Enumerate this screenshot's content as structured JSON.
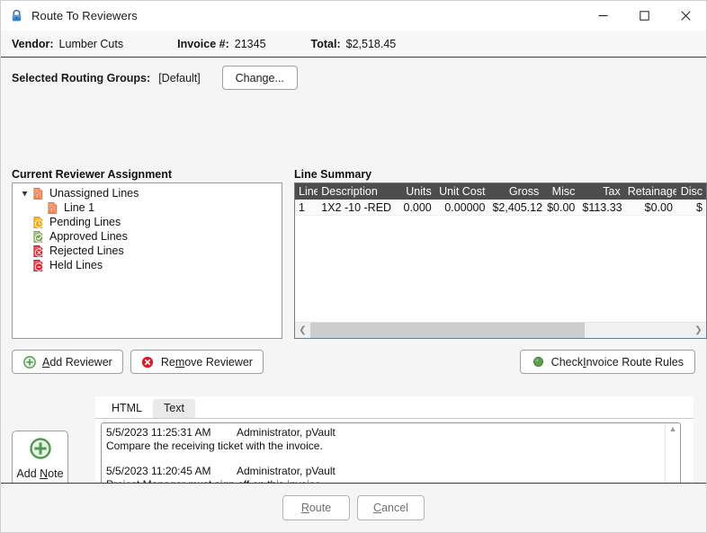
{
  "window": {
    "title": "Route To Reviewers",
    "icon": "lock-icon",
    "controls": {
      "minimize": "minimize-icon",
      "maximize": "maximize-icon",
      "close": "close-icon"
    }
  },
  "info": {
    "vendor_label": "Vendor:",
    "vendor_value": "Lumber Cuts",
    "invoice_label": "Invoice #:",
    "invoice_value": "21345",
    "total_label": "Total:",
    "total_value": "$2,518.45"
  },
  "routing": {
    "label": "Selected Routing Groups:",
    "value": "[Default]",
    "change_button": "Change..."
  },
  "left_panel": {
    "heading": "Current Reviewer Assignment",
    "tree": [
      {
        "label": "Unassigned Lines",
        "icon": "page-warning-icon",
        "color": "#e8825c",
        "level": 0,
        "expanded": true
      },
      {
        "label": "Line 1",
        "icon": "page-warning-icon",
        "color": "#e8825c",
        "level": 1,
        "expanded": false
      },
      {
        "label": "Pending Lines",
        "icon": "page-clock-icon",
        "color": "#f0a81e",
        "level": 0,
        "expanded": false
      },
      {
        "label": "Approved Lines",
        "icon": "page-check-icon",
        "color": "#7ba05b",
        "level": 0,
        "expanded": false
      },
      {
        "label": "Rejected Lines",
        "icon": "page-reject-icon",
        "color": "#e01a28",
        "level": 0,
        "expanded": false
      },
      {
        "label": "Held Lines",
        "icon": "page-hold-icon",
        "color": "#e01a28",
        "level": 0,
        "expanded": false
      }
    ]
  },
  "right_panel": {
    "heading": "Line Summary",
    "columns": [
      "Line",
      "Description",
      "Units",
      "Unit Cost",
      "Gross",
      "Misc",
      "Tax",
      "Retainage",
      "Disc"
    ],
    "rows": [
      {
        "line": "1",
        "description": "1X2 -10 -RED",
        "units": "0.000",
        "unit_cost": "0.00000",
        "gross": "$2,405.12",
        "misc": "$0.00",
        "tax": "$113.33",
        "retainage": "$0.00",
        "disc": "$"
      }
    ],
    "header_bg": "#4d4d4d",
    "header_fg": "#ffffff",
    "scroll_left": "left-arrow-icon",
    "scroll_right": "right-arrow-icon"
  },
  "actions": {
    "add_reviewer": {
      "pre": "",
      "mnem": "A",
      "post": "dd Reviewer",
      "icon": "green-plus-icon"
    },
    "remove_reviewer": {
      "pre": "Re",
      "mnem": "m",
      "post": "ove Reviewer",
      "icon": "red-x-icon"
    },
    "check_rules": {
      "pre": "Check ",
      "mnem": "I",
      "post": "nvoice Route Rules",
      "icon": "green-dot-icon"
    }
  },
  "notes": {
    "tabs": [
      {
        "label": "HTML",
        "active": false
      },
      {
        "label": "Text",
        "active": true
      }
    ],
    "entries": [
      {
        "timestamp": "5/5/2023 11:25:31 AM",
        "author": "Administrator, pVault",
        "body": "Compare the receiving ticket with the invoice."
      },
      {
        "timestamp": "5/5/2023 11:20:45 AM",
        "author": "Administrator, pVault",
        "body": "Project Manager must sign off on this invoice."
      }
    ],
    "add_note": {
      "pre": "Add ",
      "mnem": "N",
      "post": "ote",
      "icon": "green-plus-icon"
    }
  },
  "footer": {
    "route": {
      "pre": "",
      "mnem": "R",
      "post": "oute"
    },
    "cancel": {
      "pre": "",
      "mnem": "C",
      "post": "ancel"
    }
  },
  "colors": {
    "accent_green": "#4e9a4e",
    "accent_red": "#d91e2a",
    "header_dark": "#4d4d4d",
    "window_bg": "#f5f5f5"
  }
}
